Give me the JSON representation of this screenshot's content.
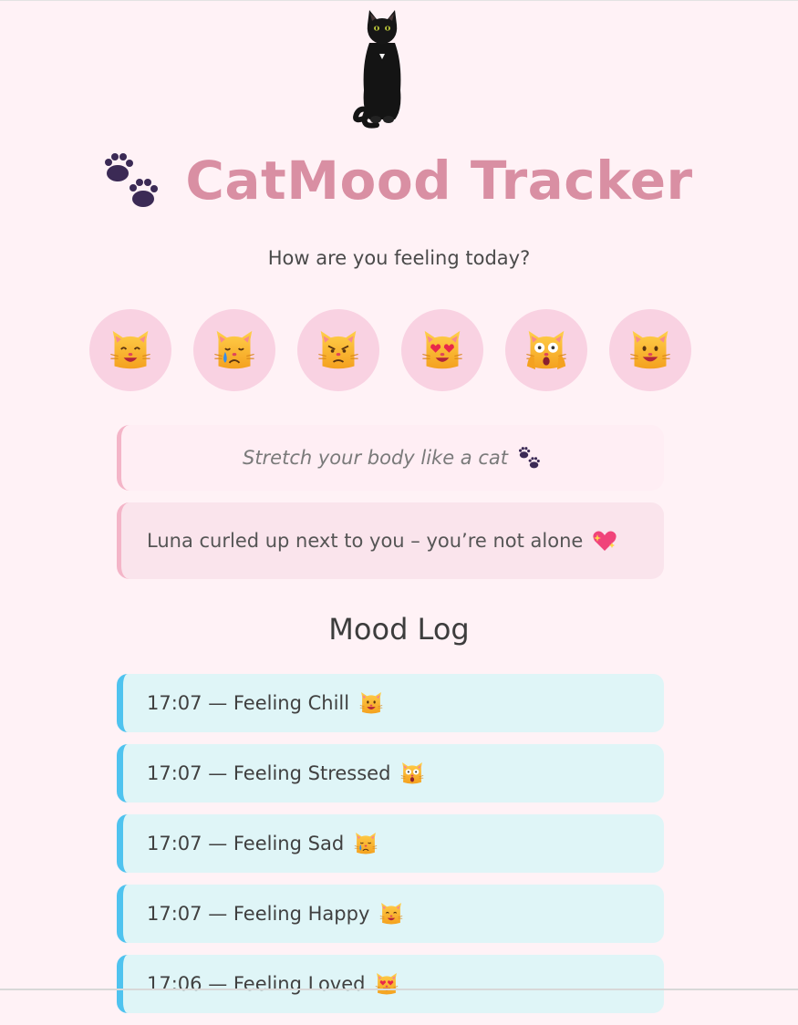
{
  "app": {
    "title": "CatMood Tracker",
    "title_icon": "paw-prints-icon",
    "hero_image": "black-cat-sitting",
    "question": "How are you feeling today?"
  },
  "moods": [
    {
      "name": "happy",
      "icon": "smiling-cat-icon"
    },
    {
      "name": "sad",
      "icon": "crying-cat-icon"
    },
    {
      "name": "angry",
      "icon": "pouting-cat-icon"
    },
    {
      "name": "loved",
      "icon": "heart-eyes-cat-icon"
    },
    {
      "name": "stressed",
      "icon": "weary-cat-icon"
    },
    {
      "name": "chill",
      "icon": "grinning-cat-icon"
    }
  ],
  "tip": {
    "text": "Stretch your body like a cat",
    "icon": "paw-prints-icon"
  },
  "companion": {
    "text": "Luna curled up next to you – you’re not alone",
    "icon": "sparkling-heart-icon"
  },
  "log": {
    "title": "Mood Log",
    "entries": [
      {
        "text": "17:07 — Feeling Chill",
        "icon": "grinning-cat-icon"
      },
      {
        "text": "17:07 — Feeling Stressed",
        "icon": "weary-cat-icon"
      },
      {
        "text": "17:07 — Feeling Sad",
        "icon": "crying-cat-icon"
      },
      {
        "text": "17:07 — Feeling Happy",
        "icon": "smiling-cat-icon"
      },
      {
        "text": "17:06 — Feeling Loved",
        "icon": "heart-eyes-cat-icon"
      }
    ]
  },
  "colors": {
    "background": "#fff2f6",
    "title": "#d98fa3",
    "mood_button": "#f9d2e2",
    "tip_box": "#ffeef4",
    "companion_box": "#fae4ec",
    "accent_pink": "#f4b5c8",
    "log_item": "#dff5f7",
    "log_accent": "#4fc3ef"
  }
}
